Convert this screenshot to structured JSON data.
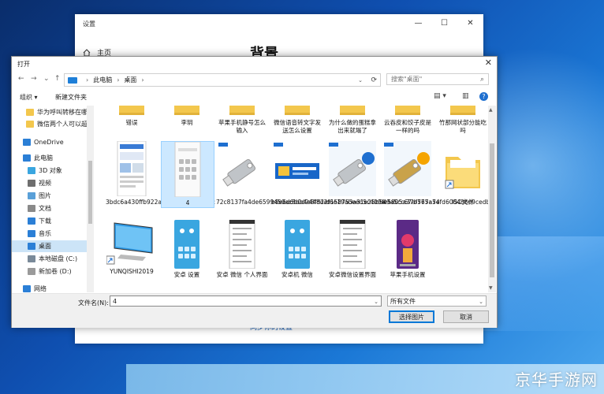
{
  "settings": {
    "title": "设置",
    "home_label": "主页",
    "heading": "背景",
    "sync_link": "同步你的设置",
    "controls": [
      "—",
      "☐",
      "✕"
    ]
  },
  "dialog": {
    "title": "打开",
    "close": "✕",
    "nav_back": "←",
    "nav_forward": "→",
    "nav_recent": "⌄",
    "nav_up": "↑",
    "breadcrumb": [
      "此电脑",
      "桌面"
    ],
    "breadcrumb_sep": "›",
    "dropdown": "⌄",
    "refresh": "⟳",
    "search_placeholder": "搜索\"桌面\"",
    "search_icon": "⌕",
    "organize": "组织 ▾",
    "new_folder": "新建文件夹",
    "view_icon": "▤ ▾",
    "pane_icon": "▥",
    "help": "?"
  },
  "nav_pane": [
    {
      "label": "华为呼叫转移在哪",
      "icon": "folder",
      "color": "#f3c74d"
    },
    {
      "label": "微信两个人可以超",
      "icon": "folder",
      "color": "#f3c74d"
    },
    {
      "label": "OneDrive",
      "icon": "cloud",
      "color": "#2b7fd6"
    },
    {
      "label": "此电脑",
      "icon": "pc",
      "color": "#2b7fd6"
    },
    {
      "label": "3D 对象",
      "icon": "cube",
      "color": "#3aa6e0"
    },
    {
      "label": "视频",
      "icon": "video",
      "color": "#6e6e6e"
    },
    {
      "label": "图片",
      "icon": "pictures",
      "color": "#5aa0d8"
    },
    {
      "label": "文档",
      "icon": "docs",
      "color": "#8a8a8a"
    },
    {
      "label": "下载",
      "icon": "download",
      "color": "#2b7fd6"
    },
    {
      "label": "音乐",
      "icon": "music",
      "color": "#2b7fd6"
    },
    {
      "label": "桌面",
      "icon": "desktop",
      "color": "#2b7fd6",
      "selected": true
    },
    {
      "label": "本地磁盘 (C:)",
      "icon": "drive",
      "color": "#7a8a99"
    },
    {
      "label": "新加卷 (D:)",
      "icon": "drive",
      "color": "#9a9a9a"
    },
    {
      "label": "网络",
      "icon": "network",
      "color": "#2b7fd6"
    }
  ],
  "files_row1": [
    "错误",
    "李玥",
    "苹果手机静号怎么输入",
    "微信语音转文字发送怎么设置",
    "为什么做的蛋糕拿出来就塌了",
    "云吞皮和饺子皮是一样的吗",
    "竹那网状部分能吃吗"
  ],
  "files_row2": [
    {
      "label": "3bdc6a430ffb922acf17b2e0d99b46c",
      "thumb": "phone"
    },
    {
      "label": "4",
      "thumb": "phone-grid",
      "selected": true
    },
    {
      "label": "72c8137fa4de6599450ac8bb4e8fd2e",
      "thumb": "usb"
    },
    {
      "label": "b8e6d6b0d9448d2f6e19abeed5c409a",
      "thumb": "banner"
    },
    {
      "label": "d158753a31e25b549a5cc67af775a74",
      "thumb": "usb-blue"
    },
    {
      "label": "fe5805a37b567a5efd600436e9cedb0",
      "thumb": "usb-gold"
    },
    {
      "label": "ISO文件",
      "thumb": "folder-shortcut"
    }
  ],
  "files_row3": [
    {
      "label": "YUNQISHI2019",
      "thumb": "monitor"
    },
    {
      "label": "安卓 设置",
      "thumb": "android-blue"
    },
    {
      "label": "安卓 微信 个人界面",
      "thumb": "settings-list"
    },
    {
      "label": "安卓机 微信",
      "thumb": "android-blue"
    },
    {
      "label": "安卓微信设置界面",
      "thumb": "settings-list"
    },
    {
      "label": "苹果手机设置",
      "thumb": "iphone-purple"
    }
  ],
  "bottom": {
    "filename_label": "文件名(N):",
    "filename_value": "4",
    "filetype_value": "所有文件",
    "open_button": "选择图片",
    "cancel_button": "取消",
    "dropdown": "⌄"
  },
  "watermark": "京华手游网"
}
